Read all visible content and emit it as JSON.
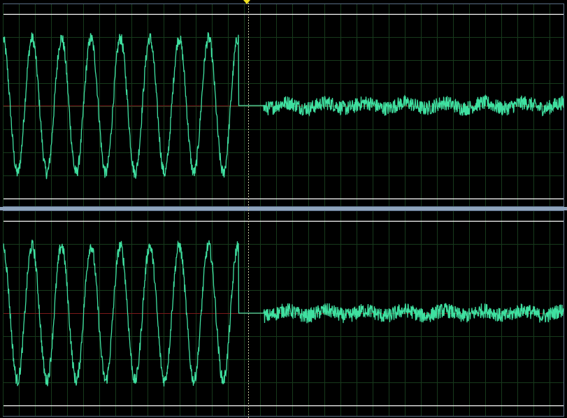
{
  "editor": {
    "view": "waveform",
    "channels": [
      "left",
      "right"
    ]
  },
  "colors": {
    "background": "#000000",
    "panel_border": "#5a6e86",
    "divider": "#8fa4bd",
    "grid": "#173a1c",
    "center_line": "#7a1a1a",
    "limit_line": "#ffffff",
    "waveform": "#3fe0a0",
    "playhead": "#c8c8a0",
    "playhead_marker": "#f0e020"
  },
  "signal": {
    "tone_cycles_visible": 8,
    "tone_amplitude": 0.73,
    "noise_amplitude": 0.08,
    "silence_fraction": [
      0.42,
      0.465
    ],
    "playhead_fraction": 0.437
  }
}
